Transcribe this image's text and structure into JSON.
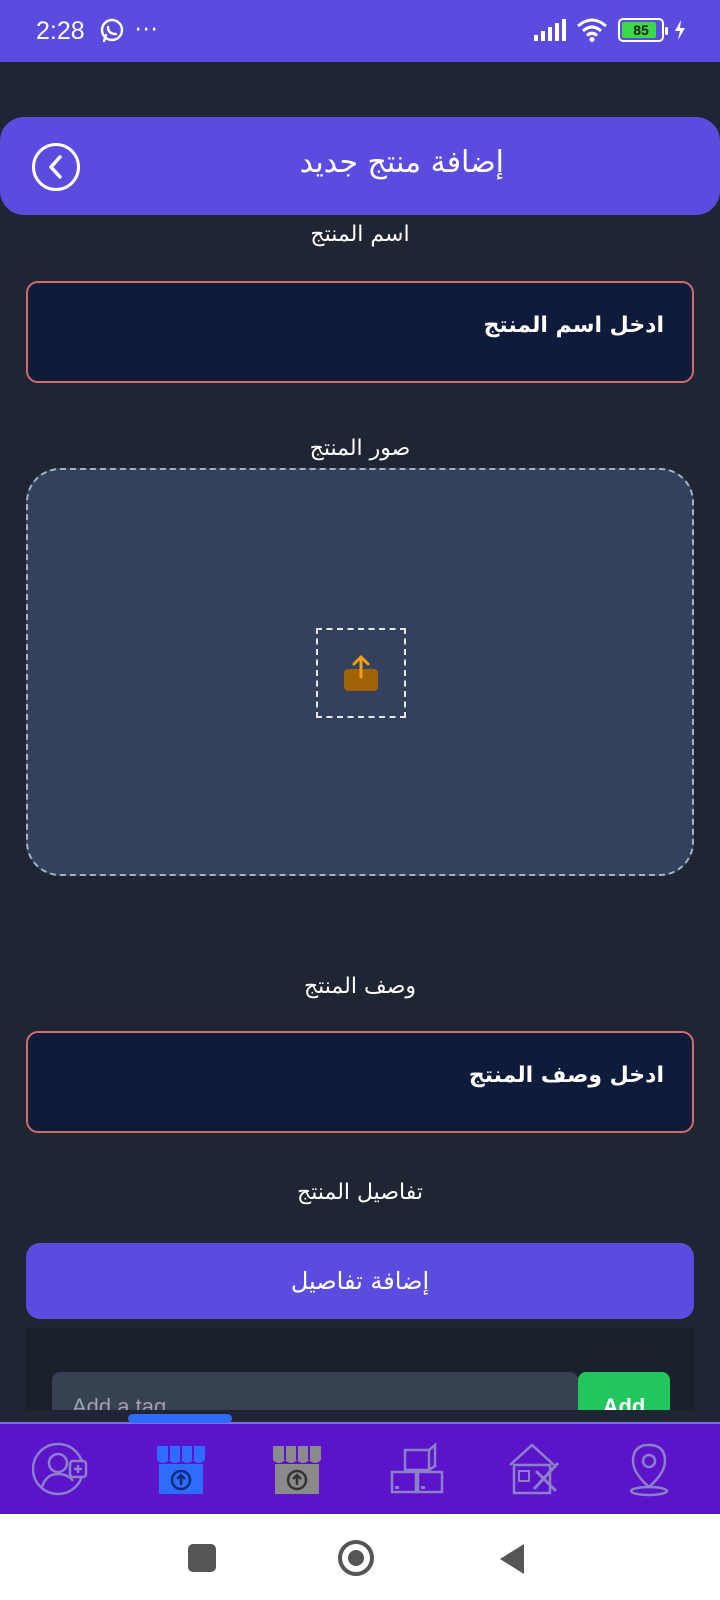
{
  "status_bar": {
    "time": "2:28",
    "dots": "···",
    "battery_level": "85",
    "icons": [
      "whatsapp-icon",
      "signal-icon",
      "wifi-icon",
      "battery-icon",
      "charging-icon"
    ]
  },
  "header": {
    "title": "إضافة منتج جديد",
    "back_icon": "chevron-left-circle-icon"
  },
  "form": {
    "name_label": "اسم المنتج",
    "name_placeholder": "ادخل اسم المنتج",
    "images_label": "صور المنتج",
    "upload_icon": "upload-icon",
    "description_label": "وصف المنتج",
    "description_placeholder": "ادخل وصف المنتج",
    "details_label": "تفاصيل المنتج",
    "add_details_button": "إضافة تفاصيل",
    "tag_placeholder": "Add a tag",
    "tag_add_button": "Add"
  },
  "bottom_nav": {
    "items": [
      {
        "icon": "add-user-icon",
        "active": false
      },
      {
        "icon": "store-upload-icon",
        "active": true
      },
      {
        "icon": "store-upload-icon",
        "active": false
      },
      {
        "icon": "boxes-icon",
        "active": false
      },
      {
        "icon": "property-tools-icon",
        "active": false
      },
      {
        "icon": "location-pin-icon",
        "active": false
      }
    ]
  },
  "colors": {
    "primary": "#5b4ce0",
    "background": "#1f2633",
    "field_bg": "#0e1b3a",
    "field_border": "#d36b6b",
    "nav_bg": "#5b14c9",
    "active_icon": "#2f6bff",
    "upload_accent": "#f59e0b",
    "add_button": "#22c55e"
  }
}
